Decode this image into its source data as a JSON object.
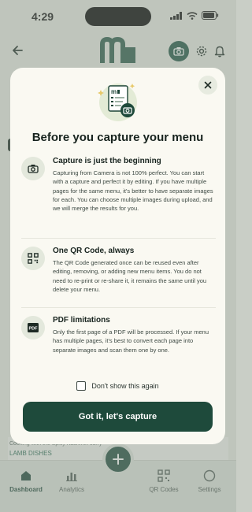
{
  "status_bar": {
    "time": "4:29"
  },
  "background": {
    "snippet_line": "Cooking with the Spicy Kashmiri curry",
    "category": "LAMB DISHES"
  },
  "tab_bar": {
    "items": [
      {
        "label": "Dashboard",
        "icon": "home-icon"
      },
      {
        "label": "Analytics",
        "icon": "bar-chart-icon"
      },
      {
        "label": "",
        "icon": "plus-icon"
      },
      {
        "label": "QR Codes",
        "icon": "qr-code-icon"
      },
      {
        "label": "Settings",
        "icon": "circle-icon"
      }
    ]
  },
  "modal": {
    "title": "Before you capture your menu",
    "sections": [
      {
        "icon": "camera-icon",
        "title": "Capture is just the beginning",
        "text": "Capturing from Camera is not 100% perfect. You can start with a capture and perfect it by editing. If you have multiple pages for the same menu, it's better to have separate images for each. You can choose multiple images during upload, and we will merge the results for you."
      },
      {
        "icon": "qr-code-icon",
        "title": "One QR Code, always",
        "text": "The QR Code generated once can be reused even after editing, removing, or adding new menu items. You do not need to re-print or re-share it, it remains the same until you delete your menu."
      },
      {
        "icon": "pdf-icon",
        "icon_text": "PDF",
        "title": "PDF limitations",
        "text": "Only the first page of a PDF will be processed. If your menu has multiple pages, it's best to convert each page into separate images and scan them one by one."
      }
    ],
    "dont_show_label": "Don't show this again",
    "dont_show_checked": false,
    "cta_label": "Got it, let's capture"
  },
  "colors": {
    "brand_dark": "#1e4a3b",
    "modal_bg": "#faf9f2",
    "icon_circle": "#e3e8dc"
  }
}
